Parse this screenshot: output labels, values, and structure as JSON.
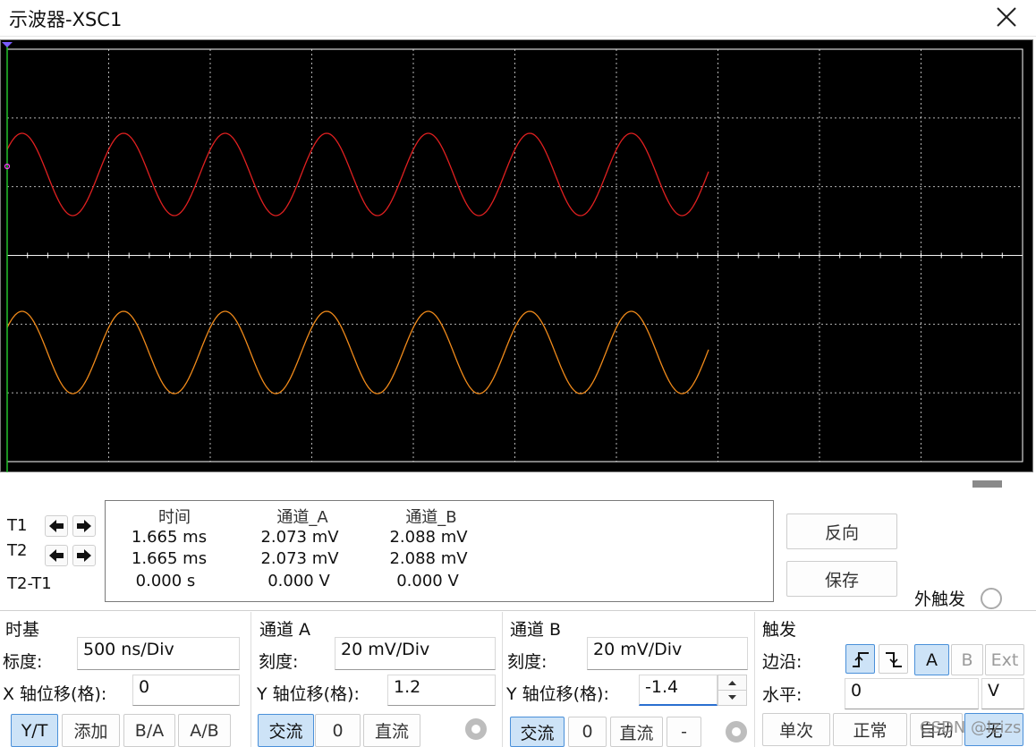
{
  "window": {
    "title": "示波器-XSC1"
  },
  "colors": {
    "channel_a": "#e02020",
    "channel_b": "#f08a1a",
    "grid": "#ffffff",
    "screen": "#000000",
    "accent": "#4a90d9"
  },
  "readout": {
    "row_labels": [
      "T1",
      "T2",
      "T2-T1"
    ],
    "headers": [
      "时间",
      "通道_A",
      "通道_B"
    ],
    "t1": [
      "1.665 ms",
      "2.073 mV",
      "2.088 mV"
    ],
    "t2": [
      "1.665 ms",
      "2.073 mV",
      "2.088 mV"
    ],
    "delta": [
      "0.000 s",
      "0.000 V",
      "0.000 V"
    ]
  },
  "buttons": {
    "reverse": "反向",
    "save": "保存",
    "ext_trigger": "外触发"
  },
  "timebase": {
    "section": "时基",
    "scale_label": "标度:",
    "scale_value": "500 ns/Div",
    "xpos_label": "X 轴位移(格):",
    "xpos_value": "0",
    "modes": [
      "Y/T",
      "添加",
      "B/A",
      "A/B"
    ]
  },
  "channel_a": {
    "section": "通道 A",
    "scale_label": "刻度:",
    "scale_value": "20 mV/Div",
    "ypos_label": "Y 轴位移(格):",
    "ypos_value": "1.2",
    "coupling": [
      "交流",
      "0",
      "直流"
    ]
  },
  "channel_b": {
    "section": "通道 B",
    "scale_label": "刻度:",
    "scale_value": "20 mV/Div",
    "ypos_label": "Y 轴位移(格):",
    "ypos_value": "-1.4",
    "coupling": [
      "交流",
      "0",
      "直流",
      "-"
    ]
  },
  "trigger": {
    "section": "触发",
    "edge_label": "边沿:",
    "level_label": "水平:",
    "level_value": "0",
    "level_unit": "V",
    "sources": [
      "A",
      "B",
      "Ext"
    ],
    "modes": [
      "单次",
      "正常",
      "自动",
      "无"
    ]
  },
  "watermark": "CSDN @lzizs"
}
